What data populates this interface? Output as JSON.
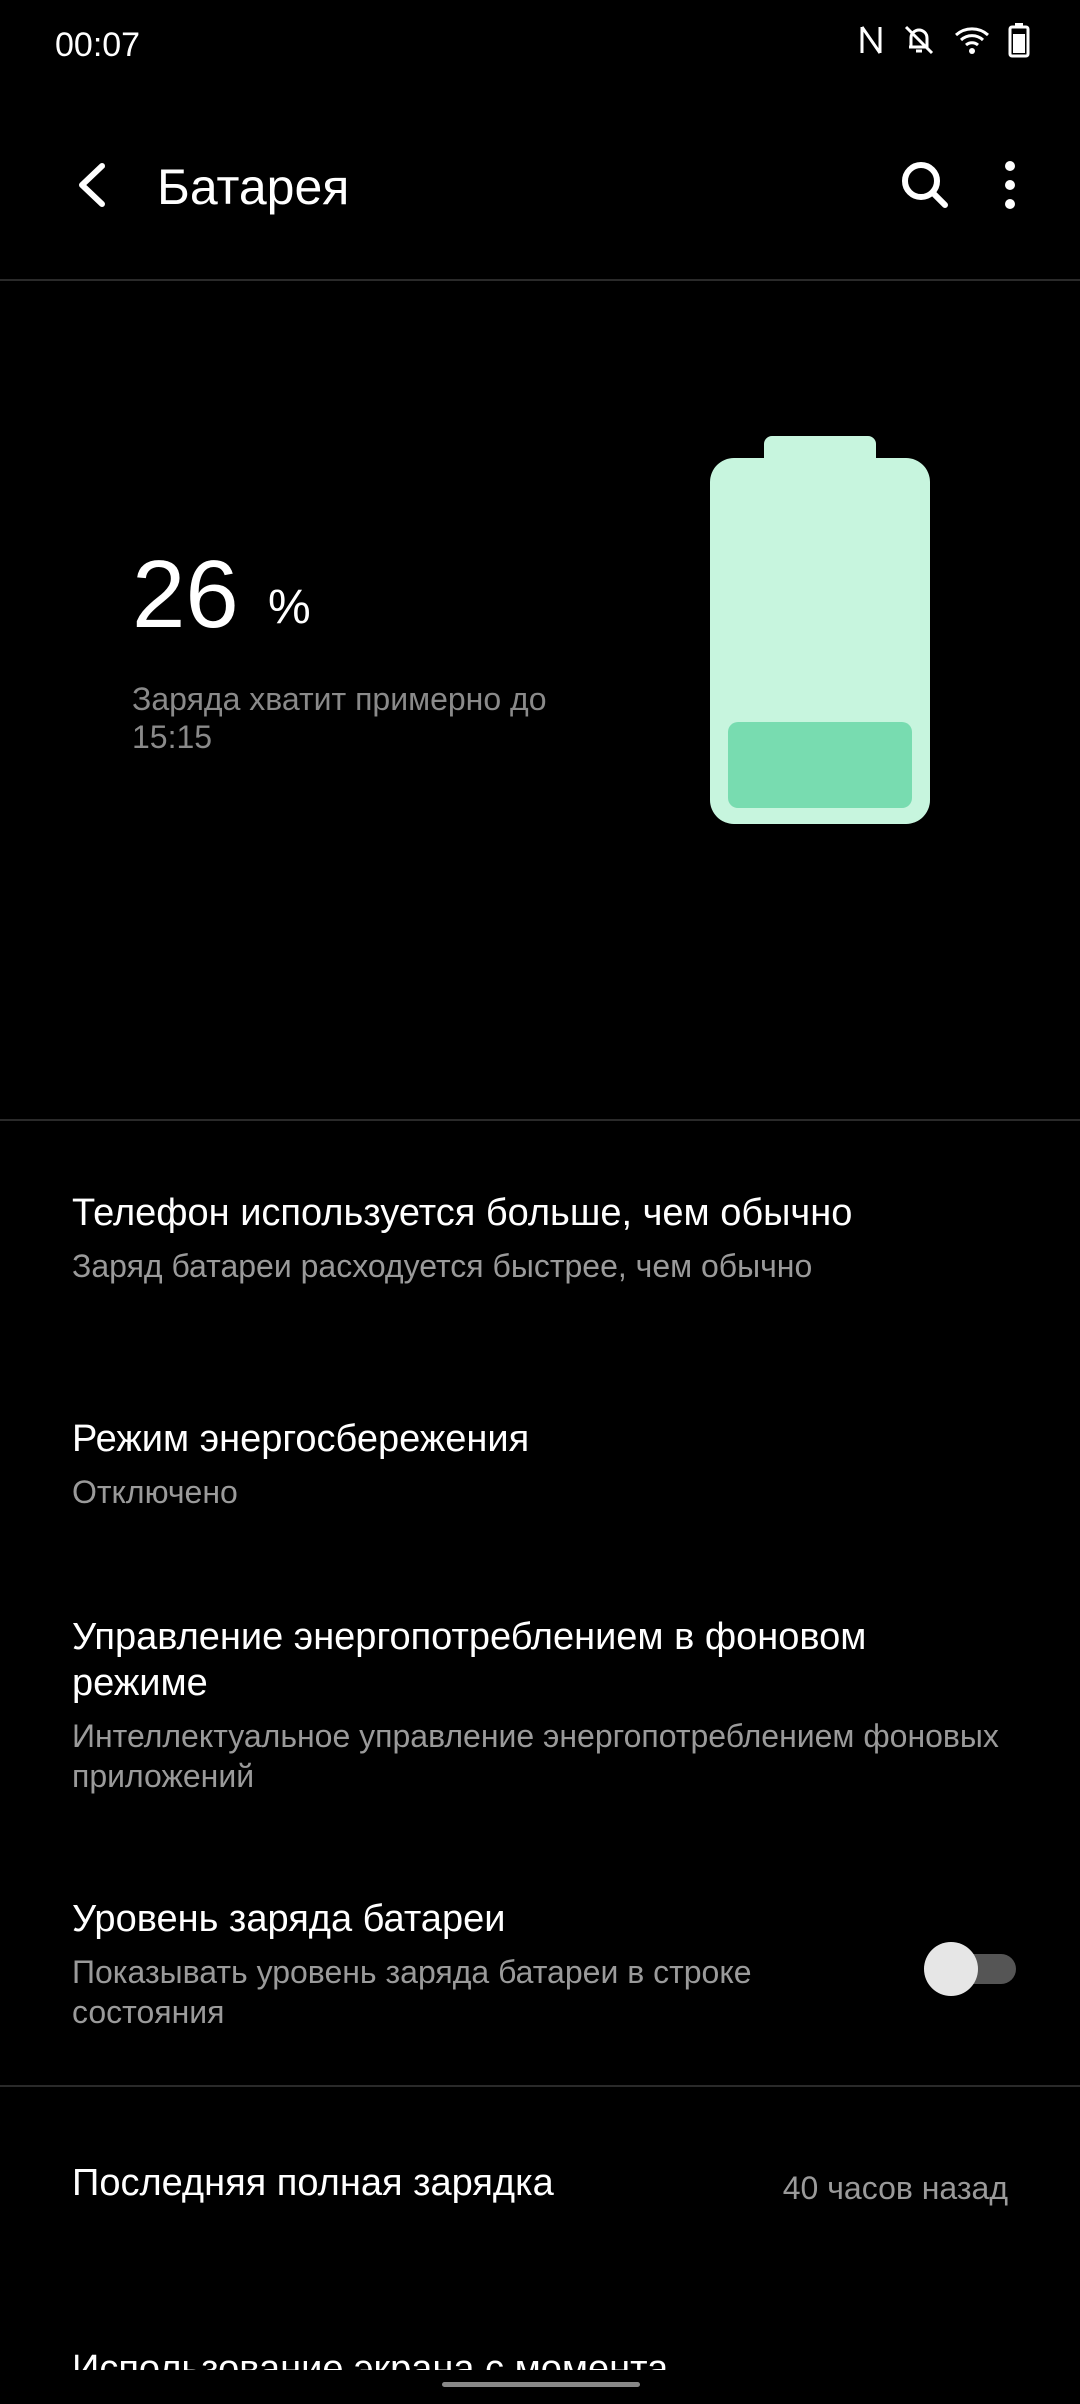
{
  "status_bar": {
    "time": "00:07",
    "icons": [
      "nfc-icon",
      "bell-off-icon",
      "wifi-icon",
      "battery-icon"
    ]
  },
  "header": {
    "title": "Батарея",
    "icons": [
      "back-arrow-icon",
      "search-icon",
      "more-vert-icon"
    ]
  },
  "battery": {
    "percent": "26",
    "percent_sign": "%",
    "estimate": "Заряда хватит примерно до 15:15",
    "level_fraction": 0.26,
    "colors": {
      "body": "#c7f5de",
      "fill": "#78dcb0"
    }
  },
  "settings": [
    {
      "title": "Телефон используется больше, чем обычно",
      "subtitle": "Заряд батареи расходуется быстрее, чем обычно"
    },
    {
      "title": "Режим энергосбережения",
      "subtitle": "Отключено"
    },
    {
      "title": "Управление энергопотреблением в фоновом режиме",
      "subtitle": "Интеллектуальное управление энергопотреблением фоновых приложений"
    },
    {
      "title": "Уровень заряда батареи",
      "subtitle": "Показывать уровень заряда батареи в строке состояния",
      "toggle_on": false
    }
  ],
  "last_charge": {
    "label": "Последняя полная зарядка",
    "value": "40 часов назад"
  },
  "next_item_partial": "Использование экрана с момента"
}
